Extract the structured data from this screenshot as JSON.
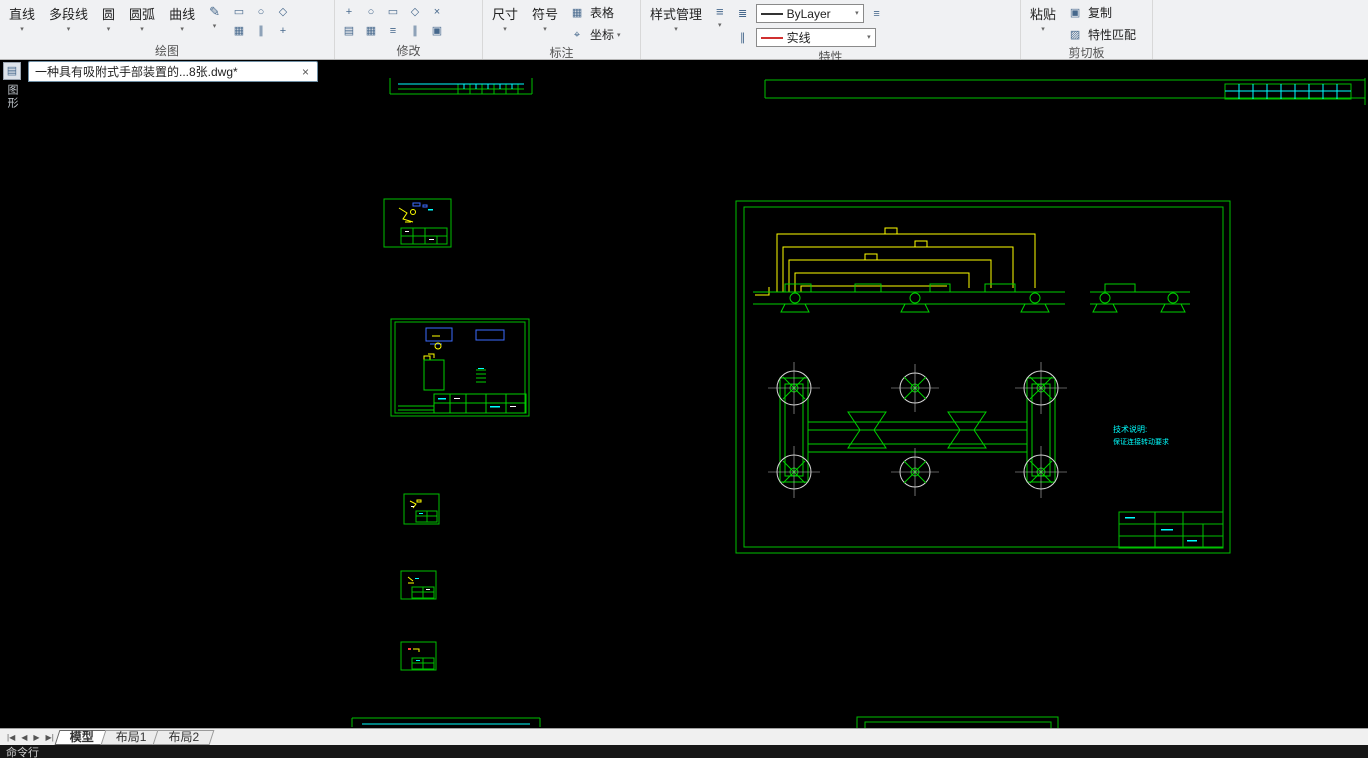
{
  "icons": {
    "caret": "▾",
    "close": "×",
    "pencil": "✎",
    "rect": "▭",
    "circle": "○",
    "diamond": "◇",
    "grid": "▦",
    "parallel": "∥",
    "plus": "+",
    "cross": "×",
    "lines": "≡",
    "layers": "≣",
    "target": "⌖",
    "table": "▦",
    "copy": "▣",
    "brush": "▨",
    "paste": "▤",
    "nav_first": "|◀",
    "nav_prev": "◀",
    "nav_next": "▶",
    "nav_last": "▶|"
  },
  "ribbon": {
    "draw_panel": {
      "label": "绘图",
      "buttons": [
        {
          "label": "直线"
        },
        {
          "label": "多段线"
        },
        {
          "label": "圆"
        },
        {
          "label": "圆弧"
        },
        {
          "label": "曲线"
        }
      ]
    },
    "modify_panel": {
      "label": "修改"
    },
    "annotate_panel": {
      "label": "标注",
      "dimension": "尺寸",
      "symbol": "符号",
      "table": "表格",
      "coordinate": "坐标"
    },
    "properties_panel": {
      "label": "特性",
      "style_manager": "样式管理",
      "layer_value": "ByLayer",
      "linetype_value": "实线"
    },
    "clipboard_panel": {
      "label": "剪切板",
      "paste": "粘贴",
      "copy": "复制",
      "match": "特性匹配"
    }
  },
  "file_tab": {
    "title": "一种具有吸附式手部装置的...8张.dwg*"
  },
  "side_toolbar": {
    "label": "图形"
  },
  "drawing": {
    "tech_note_title": "技术说明:",
    "tech_note_line": "保证连接转动要求"
  },
  "sheet_bar": {
    "tabs": [
      {
        "label": "模型"
      },
      {
        "label": "布局1"
      },
      {
        "label": "布局2"
      }
    ]
  },
  "command_bar": {
    "prompt": "命令行"
  },
  "colors": {
    "sheet_green": "#00bf00",
    "bright_green": "#00d000",
    "yellow": "#ffff00",
    "cyan": "#00ffff",
    "blue": "#3b6bff",
    "canvas_bg": "#000000",
    "ribbon_bg": "#f0f1f3"
  }
}
